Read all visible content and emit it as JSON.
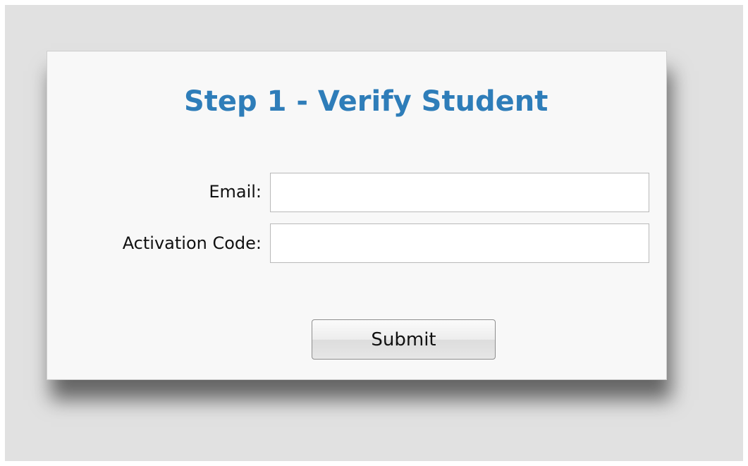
{
  "form": {
    "title": "Step 1 - Verify Student",
    "fields": [
      {
        "label": "Email:",
        "value": "",
        "placeholder": ""
      },
      {
        "label": "Activation Code:",
        "value": "",
        "placeholder": ""
      }
    ],
    "submit_label": "Submit"
  },
  "colors": {
    "title": "#2e7db9",
    "panel": "#f8f8f8",
    "backdrop": "#e1e1e1"
  }
}
